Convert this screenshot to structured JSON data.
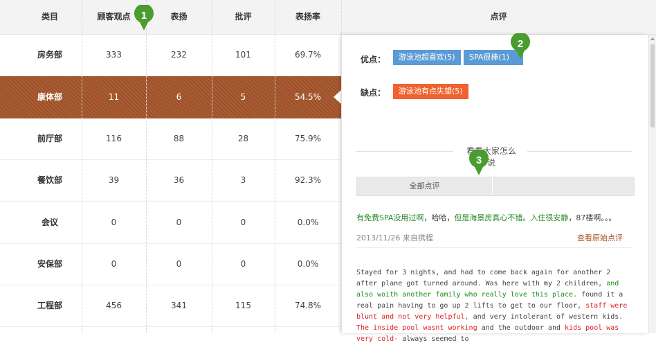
{
  "table": {
    "headers": [
      "类目",
      "顾客观点",
      "表扬",
      "批评",
      "表扬率",
      "点评"
    ],
    "rows": [
      {
        "category": "房务部",
        "opinions": "333",
        "praise": "232",
        "criticism": "101",
        "rate": "69.7%"
      },
      {
        "category": "康体部",
        "opinions": "11",
        "praise": "6",
        "criticism": "5",
        "rate": "54.5%"
      },
      {
        "category": "前厅部",
        "opinions": "116",
        "praise": "88",
        "criticism": "28",
        "rate": "75.9%"
      },
      {
        "category": "餐饮部",
        "opinions": "39",
        "praise": "36",
        "criticism": "3",
        "rate": "92.3%"
      },
      {
        "category": "会议",
        "opinions": "0",
        "praise": "0",
        "criticism": "0",
        "rate": "0.0%"
      },
      {
        "category": "安保部",
        "opinions": "0",
        "praise": "0",
        "criticism": "0",
        "rate": "0.0%"
      },
      {
        "category": "工程部",
        "opinions": "456",
        "praise": "341",
        "criticism": "115",
        "rate": "74.8%"
      }
    ],
    "active_row_index": 1,
    "active_color": "#a5552a"
  },
  "panel": {
    "pros_label": "优点：",
    "pros_tags": [
      "游泳池超喜欢(5)",
      "SPA很棒(1)"
    ],
    "cons_label": "缺点：",
    "cons_tags": [
      "游泳池有点失望(5)"
    ],
    "section_title": "看看大家怎么说",
    "tabs": [
      "全部点评",
      ""
    ],
    "review1": {
      "p1": "有免费SPA没用过啊",
      "p2": "，哈哈，",
      "p3": "但是海景房真心不错。入住很安静",
      "p4": "，87楼啊。。。",
      "date": "2013/11/26",
      "source": "来自携程",
      "link": "查看原始点评"
    },
    "review2": {
      "s1": "Stayed for 3 nights, and had to come back again for another 2 after plane got turned around. Was here with my 2 children, ",
      "s2": "and also woith another family who really love this place.",
      "s3": " found it a real pain having to go up 2 lifts to get to our floor, ",
      "s4": "staff were blunt and not very helpful,",
      "s5": " and very intolerant of western kids. ",
      "s6": "The inside pool wasnt working",
      "s7": " and the outdoor and ",
      "s8": "kids pool was very cold-",
      "s9": " always seemed to"
    }
  },
  "markers": [
    "1",
    "2",
    "3"
  ],
  "colors": {
    "tag_blue": "#5b9bd5",
    "tag_orange": "#f0622e",
    "marker_green": "#4a9c2f",
    "positive_text": "#2a8a2a",
    "negative_text": "#e02020"
  }
}
